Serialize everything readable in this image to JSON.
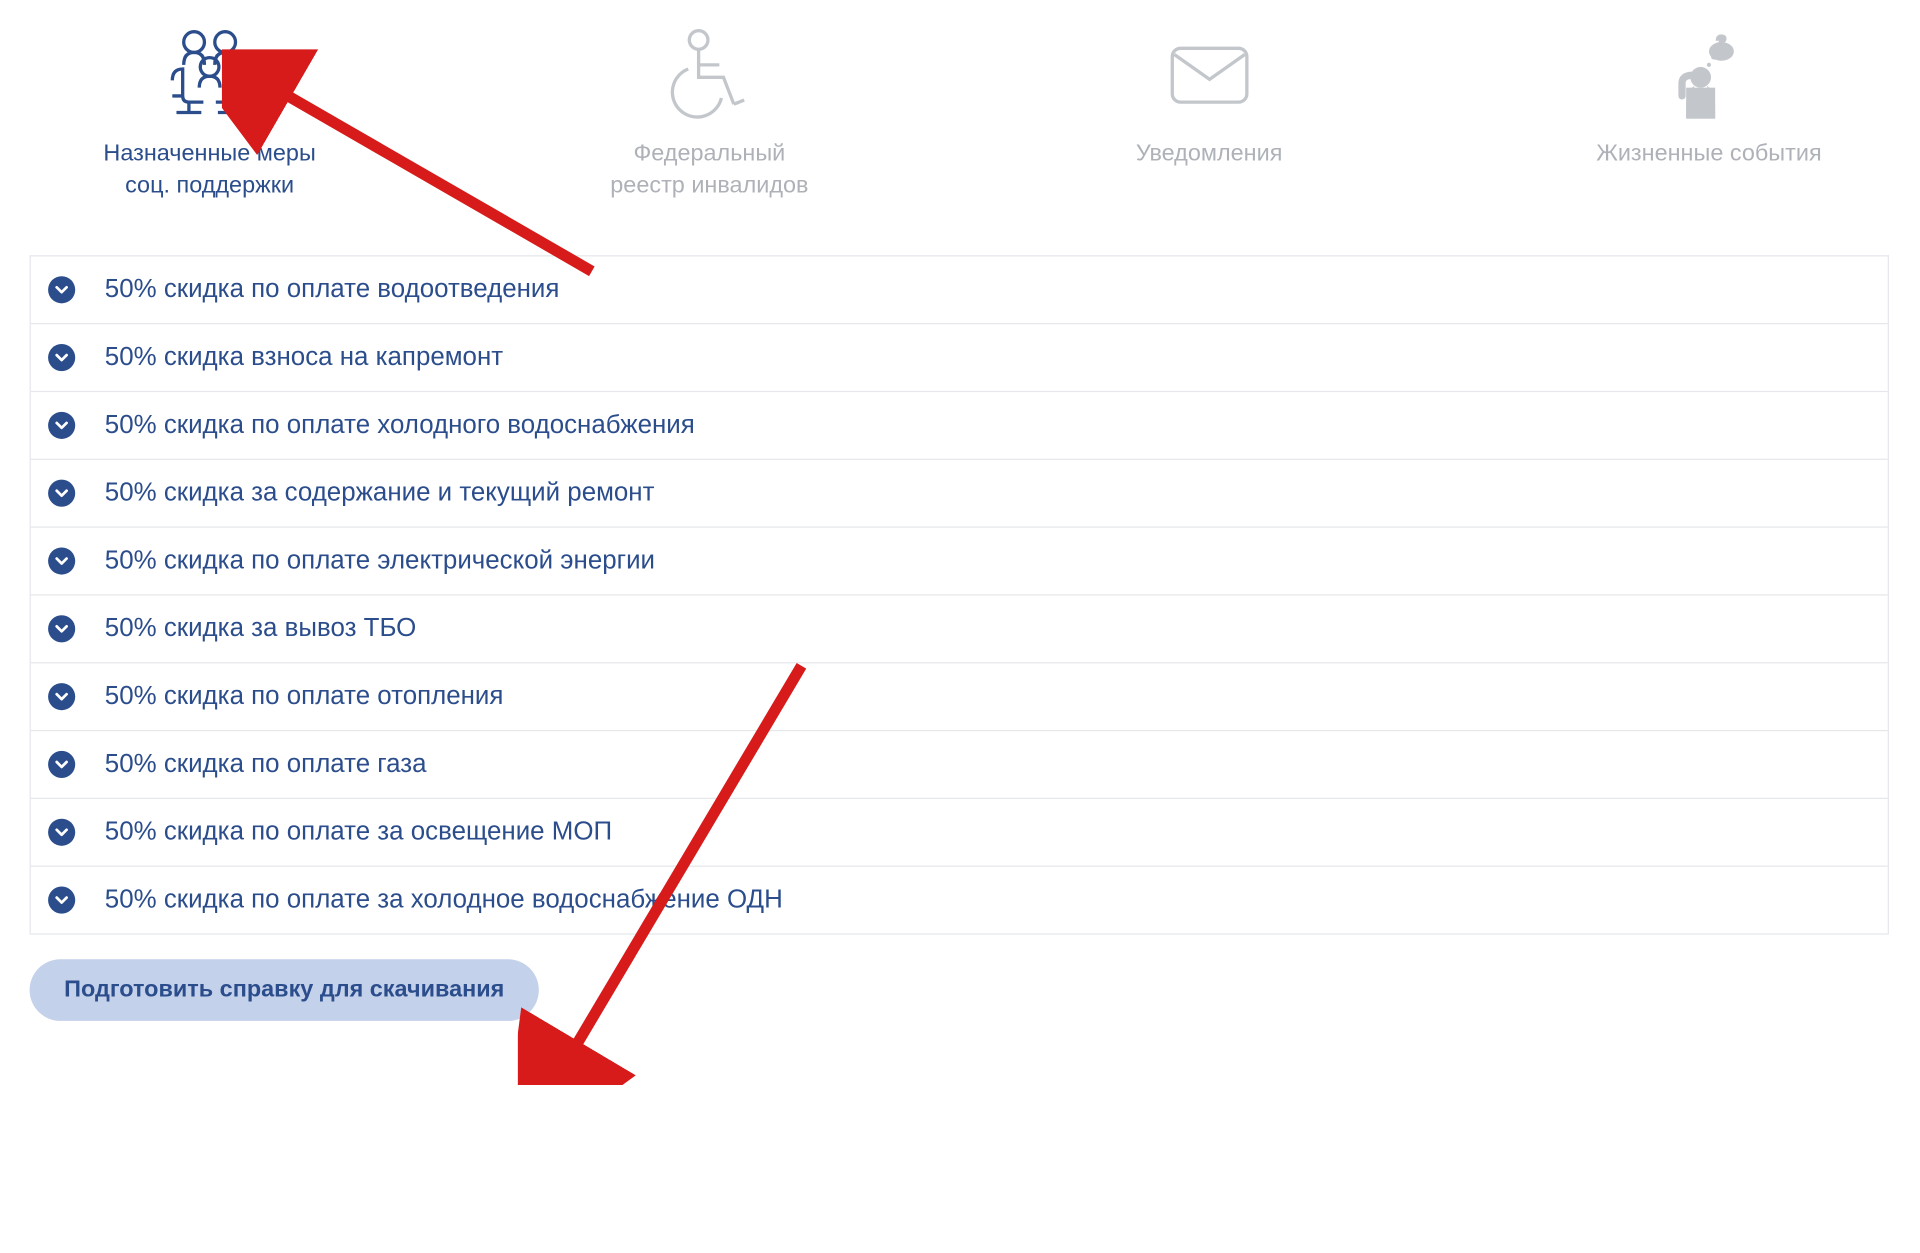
{
  "tabs": [
    {
      "label_line1": "Назначенные меры",
      "label_line2": "соц. поддержки",
      "active": true
    },
    {
      "label_line1": "Федеральный",
      "label_line2": "реестр инвалидов",
      "active": false
    },
    {
      "label_line1": "Уведомления",
      "label_line2": "",
      "active": false
    },
    {
      "label_line1": "Жизненные события",
      "label_line2": "",
      "active": false
    }
  ],
  "discounts": [
    {
      "text": "50% скидка по оплате водоотведения"
    },
    {
      "text": "50% скидка взноса на капремонт"
    },
    {
      "text": "50% скидка по оплате холодного водоснабжения"
    },
    {
      "text": "50% скидка за содержание и текущий ремонт"
    },
    {
      "text": "50% скидка по оплате электрической энергии"
    },
    {
      "text": "50% скидка за вывоз ТБО"
    },
    {
      "text": "50% скидка по оплате отопления"
    },
    {
      "text": "50% скидка по оплате газа"
    },
    {
      "text": "50% скидка по оплате за освещение МОП"
    },
    {
      "text": "50% скидка по оплате за холодное водоснабжение ОДН"
    }
  ],
  "button": {
    "label": "Подготовить справку для скачивания"
  },
  "colors": {
    "accent": "#2b4d8c",
    "inactive": "#aeb2b8",
    "annotation": "#d71a1a"
  }
}
